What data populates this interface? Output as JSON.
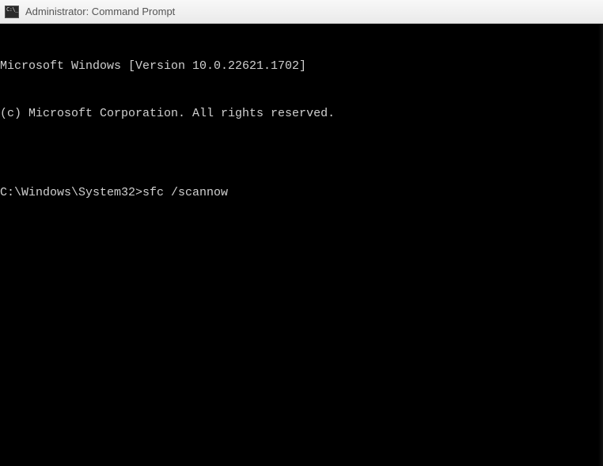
{
  "window": {
    "title": "Administrator: Command Prompt",
    "icon_name": "cmd-icon"
  },
  "terminal": {
    "lines": [
      "Microsoft Windows [Version 10.0.22621.1702]",
      "(c) Microsoft Corporation. All rights reserved.",
      ""
    ],
    "prompt": "C:\\Windows\\System32>",
    "command": "sfc /scannow"
  }
}
